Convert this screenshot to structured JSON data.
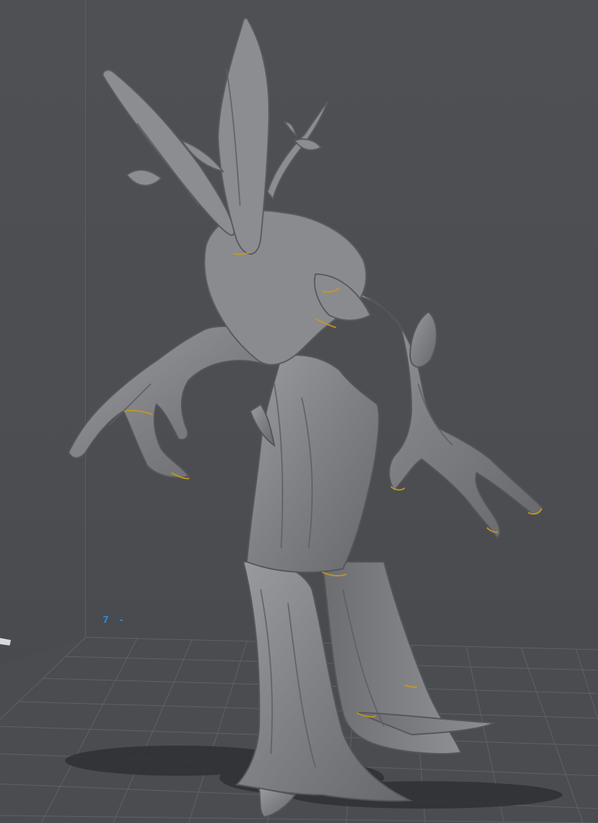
{
  "viewport": {
    "axis_marker_text": "7 -",
    "colors": {
      "background": "#4d4f53",
      "grid_line": "#5f6166",
      "model_gray": "#8a8b8e",
      "overhang_highlight": "#c89a1c",
      "axis_blue": "#2f8fd8"
    },
    "model_name_icon": "treant-sculpt-model",
    "floor_icon": "build-plate-grid",
    "handle_icon": "gizmo-handle-icon"
  }
}
